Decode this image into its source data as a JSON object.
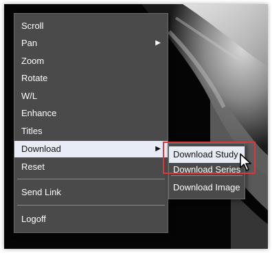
{
  "context_menu": {
    "items": [
      {
        "label": "Scroll"
      },
      {
        "label": "Pan",
        "submenu_arrow": "▶"
      },
      {
        "label": "Zoom"
      },
      {
        "label": "Rotate"
      },
      {
        "label": "W/L"
      },
      {
        "label": "Enhance"
      },
      {
        "label": "Titles"
      },
      {
        "label": "Download",
        "submenu_arrow": "▶"
      },
      {
        "label": "Reset"
      },
      {
        "label": "Send Link"
      },
      {
        "label": "Logoff"
      }
    ]
  },
  "download_submenu": {
    "items": [
      {
        "label": "Download Study"
      },
      {
        "label": "Download Series"
      },
      {
        "label": "Download Image"
      }
    ]
  },
  "colors": {
    "menu_bg": "#4a4a4a",
    "highlight_bg": "#e8ecf7",
    "annotation_red": "#e0353a"
  }
}
